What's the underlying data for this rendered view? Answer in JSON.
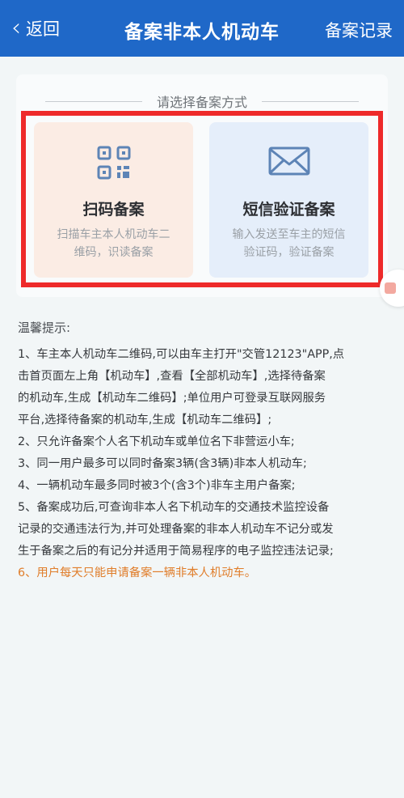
{
  "header": {
    "back_label": "返回",
    "title": "备案非本人机动车",
    "records_label": "备案记录"
  },
  "section": {
    "heading": "请选择备案方式"
  },
  "options": [
    {
      "name": "扫码备案",
      "desc_lines": [
        "扫描车主本人机动车二",
        "维码，识读备案"
      ],
      "icon": "qr-code-icon"
    },
    {
      "name": "短信验证备案",
      "desc_lines": [
        "输入发送至车主的短信",
        "验证码，验证备案"
      ],
      "icon": "envelope-icon"
    }
  ],
  "tips": {
    "title": "温馨提示:",
    "lines": [
      "1、车主本人机动车二维码,可以由车主打开\"交管12123\"APP,点",
      "击首页面左上角【机动车】,查看【全部机动车】,选择待备案",
      "的机动车,生成【机动车二维码】;单位用户可登录互联网服务",
      "平台,选择待备案的机动车,生成【机动车二维码】;",
      "2、只允许备案个人名下机动车或单位名下非营运小车;",
      "3、同一用户最多可以同时备案3辆(含3辆)非本人机动车;",
      "4、一辆机动车最多同时被3个(含3个)非车主用户备案;",
      "5、备案成功后,可查询非本人名下机动车的交通技术监控设备",
      "记录的交通违法行为,并可处理备案的非本人机动车不记分或发",
      "生于备案之后的有记分并适用于简易程序的电子监控违法记录;",
      "6、用户每天只能申请备案一辆非本人机动车。"
    ]
  },
  "colors": {
    "header_bg": "#1f68c8",
    "highlight_box": "#ee2a2a",
    "icon": "#5d84b6",
    "highlight_tip": "#e07d2a"
  }
}
